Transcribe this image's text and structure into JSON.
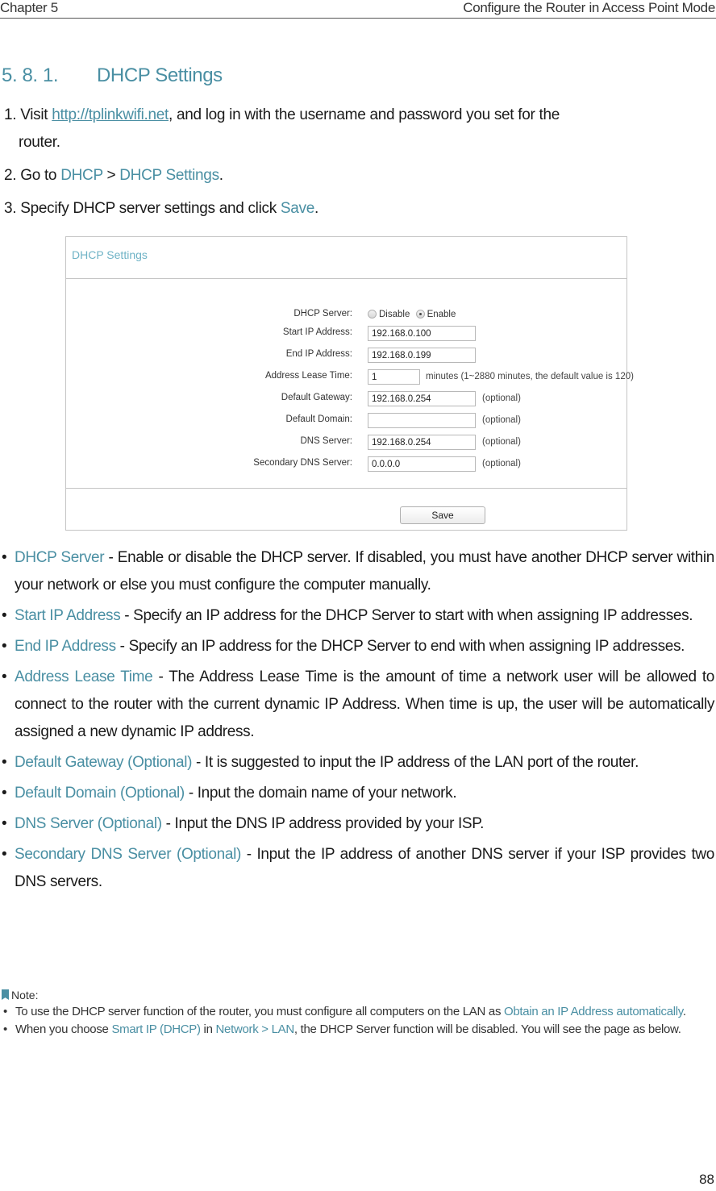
{
  "header": {
    "chapter": "Chapter 5",
    "chapter_title": "Configure the Router in Access Point Mode"
  },
  "section": {
    "number": "5. 8. 1.",
    "title": "DHCP Settings"
  },
  "steps": [
    {
      "prefix": "1. Visit ",
      "link": "http://tplinkwifi.net",
      "suffix": ", and log in with the username and password you set for the",
      "cont": "router."
    },
    {
      "prefix": "2. Go to ",
      "menu1": "DHCP",
      "sep": " > ",
      "menu2": "DHCP Settings",
      "suffix": "."
    },
    {
      "prefix": "3. Specify DHCP server settings and click ",
      "action": "Save",
      "suffix": "."
    }
  ],
  "screenshot": {
    "title": "DHCP Settings",
    "dhcp_server": {
      "label": "DHCP Server:",
      "options": [
        "Disable",
        "Enable"
      ],
      "selected": "Enable"
    },
    "fields": [
      {
        "label": "Start IP Address:",
        "value": "192.168.0.100",
        "hint": ""
      },
      {
        "label": "End IP Address:",
        "value": "192.168.0.199",
        "hint": ""
      },
      {
        "label": "Address Lease Time:",
        "value": "1",
        "hint": "minutes (1~2880 minutes, the default value is 120)"
      },
      {
        "label": "Default Gateway:",
        "value": "192.168.0.254",
        "hint": "(optional)"
      },
      {
        "label": "Default Domain:",
        "value": "",
        "hint": "(optional)"
      },
      {
        "label": "DNS Server:",
        "value": "192.168.0.254",
        "hint": "(optional)"
      },
      {
        "label": "Secondary DNS Server:",
        "value": "0.0.0.0",
        "hint": "(optional)"
      }
    ],
    "save_label": "Save"
  },
  "bullets": [
    {
      "term": "DHCP Server",
      "text": " - Enable or disable the DHCP server. If disabled, you must have another DHCP server within your network or else you must configure the computer manually."
    },
    {
      "term": "Start IP Address",
      "text": " - Specify an IP address for the DHCP Server to start with when assigning IP addresses."
    },
    {
      "term": "End IP Address",
      "text": " - Specify an IP address for the DHCP Server to end with when assigning IP addresses."
    },
    {
      "term": "Address Lease Time",
      "text": " - The Address Lease Time is the amount of time a network user will be allowed to connect to the router with the current dynamic IP Address. When time is up, the user will be automatically assigned a new dynamic IP address."
    },
    {
      "term": "Default Gateway (Optional)",
      "text": " - It is suggested to input the IP address of the LAN port of the router."
    },
    {
      "term": "Default Domain (Optional)",
      "text": " - Input the domain name of your network."
    },
    {
      "term": "DNS Server (Optional)",
      "text": " - Input the DNS IP address provided by your ISP."
    },
    {
      "term": "Secondary DNS Server (Optional)",
      "text": " - Input the IP address of another DNS server if your ISP provides two DNS servers."
    }
  ],
  "note": {
    "heading": "Note:",
    "items": [
      {
        "pre": "To use the DHCP server function of the router, you must configure all computers on the LAN as ",
        "hl1": "Obtain an IP Address automatically",
        "mid1": ".",
        "hl2": "",
        "mid2": "",
        "hl3": "",
        "post": ""
      },
      {
        "pre": "When you choose ",
        "hl1": "Smart IP (DHCP)",
        "mid1": " in ",
        "hl2": "Network",
        "mid2": " > ",
        "hl3": "LAN",
        "post": ", the DHCP Server function will be disabled. You will see the page as below."
      }
    ]
  },
  "page_number": "88",
  "colors": {
    "accent": "#4a8fa3",
    "panel_title": "#6fb3c6",
    "border": "#c4c4c4"
  }
}
